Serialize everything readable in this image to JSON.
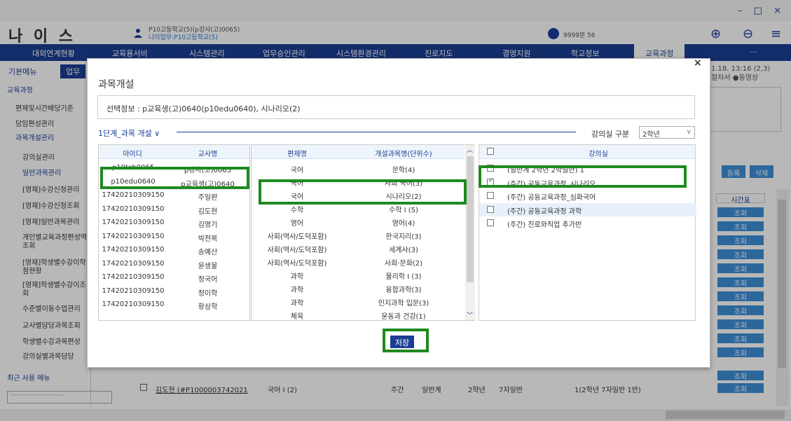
{
  "window": {
    "controls": "– □ ×"
  },
  "app": {
    "logo": "나 이 스",
    "user_line1": "P10고등학교(5)(p강사(고)0065)",
    "user_line2": "나의업무:P10고등학교(5)",
    "timer": "9999분 56"
  },
  "nav": {
    "items": [
      "대외연계현황",
      "교육용서비",
      "시스템관리",
      "업무승인관리",
      "시스템환경관리",
      "진로지도",
      "결영지원",
      "학교정보",
      "교육과정"
    ],
    "more": "···"
  },
  "sidebar": {
    "tabs": [
      "기본메뉴",
      "업무"
    ],
    "section": "교육과정",
    "items": [
      "편제및시간배당기준",
      "담임편성관리",
      "과목개설관리",
      "강의실관리",
      "일반과목관리",
      "[영재]수강신청관리",
      "[영재]수강신청조회",
      "[영재]일반과목관리",
      "개인별교육과정편성역조회",
      "[영재]학생별수강이학점현황",
      "[영재]학생별수강이조회",
      "수준별이동수업관리",
      "교사별담당과목조회",
      "학생별수강과목편성",
      "강의실별과목담당"
    ],
    "recent": "최근 사용 메뉴",
    "recent_select": "-----------------------"
  },
  "bg": {
    "date": "1.18. 13:16 (2,3)",
    "help": "절차서  ●동영상",
    "btn_register": "등록",
    "btn_delete": "삭제",
    "timetable": "시간표",
    "view": "조회",
    "rows": [
      {
        "name": "김도현 (#P1000003742021",
        "subject": "국어 I (2)",
        "time": "주간",
        "type": "일반계",
        "grade": "2학년",
        "cls": "7자일반",
        "desc": "1(2학년 7자일반 1반)"
      }
    ]
  },
  "modal": {
    "title": "과목개설",
    "close": "×",
    "selection": "선택정보 : p교육생(고)0640(p10edu0640), 시나리오(2)",
    "step": "1단계_과목 개설",
    "room_label": "강의실 구분",
    "room_value": "2학년",
    "save": "저장",
    "teachers": {
      "headers": [
        "아이디",
        "교사명"
      ],
      "rows": [
        [
          "p10tch0065",
          "p강사(고)0065"
        ],
        [
          "p10edu0640",
          "p교육생(고)0640"
        ],
        [
          "17420210309150",
          "주일판"
        ],
        [
          "17420210309150",
          "김도현"
        ],
        [
          "17420210309150",
          "김영기"
        ],
        [
          "17420210309150",
          "박전복"
        ],
        [
          "17420210309150",
          "송예산"
        ],
        [
          "17420210309150",
          "윤생물"
        ],
        [
          "17420210309150",
          "정국어"
        ],
        [
          "17420210309150",
          "정이학"
        ],
        [
          "17420210309150",
          "황삼학"
        ]
      ]
    },
    "subjects": {
      "headers": [
        "편제명",
        "개설과목명(단위수)"
      ],
      "rows": [
        [
          "국어",
          "문학(4)"
        ],
        [
          "국어",
          "사회 국어(3)"
        ],
        [
          "국어",
          "시나리오(2)"
        ],
        [
          "수학",
          "수학 I (5)"
        ],
        [
          "영어",
          "영어(4)"
        ],
        [
          "사회(역사/도덕포함)",
          "한국지리(3)"
        ],
        [
          "사회(역사/도덕포함)",
          "세계사(3)"
        ],
        [
          "사회(역사/도덕포함)",
          "사회·문화(2)"
        ],
        [
          "과학",
          "물리학 I (3)"
        ],
        [
          "과학",
          "융합과학(3)"
        ],
        [
          "과학",
          "인지과학 입문(3)"
        ],
        [
          "체육",
          "운동과 건강(1)"
        ]
      ]
    },
    "rooms": {
      "header": "강의실",
      "rows": [
        {
          "label": "(일반계 2학년 2학일반) 1",
          "checked": false
        },
        {
          "label": "(주간) 공동교육과정_시나리오",
          "checked": true
        },
        {
          "label": "(주간) 공동교육과정_심화국어",
          "checked": false
        },
        {
          "label": "(주간) 공동교육과정 과학",
          "checked": false
        },
        {
          "label": "(주간) 진로와직업 추가반",
          "checked": false
        }
      ]
    }
  },
  "colors": {
    "nav": "#1b3e94",
    "highlight": "#1e8a1e",
    "accent": "#3d8fd9"
  }
}
